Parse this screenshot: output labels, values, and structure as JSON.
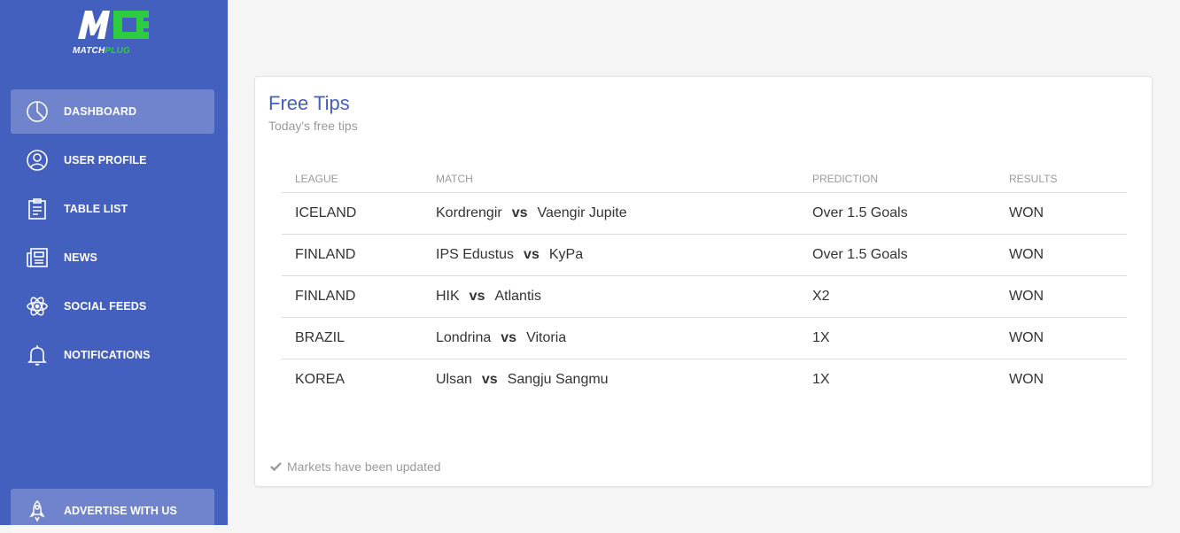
{
  "brand": {
    "logo_letters": "MC",
    "word_part1": "MATCH",
    "word_part2": "PLUG",
    "accent": "#2ecc40",
    "sidebar_color": "#4460bf"
  },
  "sidebar": {
    "items": [
      {
        "label": "DASHBOARD",
        "icon": "pie-chart-icon",
        "active": true
      },
      {
        "label": "USER PROFILE",
        "icon": "user-icon",
        "active": false
      },
      {
        "label": "TABLE LIST",
        "icon": "clipboard-icon",
        "active": false
      },
      {
        "label": "NEWS",
        "icon": "newspaper-icon",
        "active": false
      },
      {
        "label": "SOCIAL FEEDS",
        "icon": "atom-icon",
        "active": false
      },
      {
        "label": "NOTIFICATIONS",
        "icon": "bell-icon",
        "active": false
      }
    ],
    "bottom": {
      "label": "ADVERTISE WITH US",
      "icon": "rocket-icon"
    }
  },
  "card": {
    "title": "Free Tips",
    "subtitle": "Today's free tips",
    "columns": [
      "LEAGUE",
      "MATCH",
      "PREDICTION",
      "RESULTS"
    ],
    "vs_label": "vs",
    "rows": [
      {
        "league": "ICELAND",
        "home": "Kordrengir",
        "away": "Vaengir Jupite",
        "prediction": "Over 1.5 Goals",
        "result": "WON"
      },
      {
        "league": "FINLAND",
        "home": "IPS Edustus",
        "away": "KyPa",
        "prediction": "Over 1.5 Goals",
        "result": "WON"
      },
      {
        "league": "FINLAND",
        "home": "HIK",
        "away": "Atlantis",
        "prediction": "X2",
        "result": "WON"
      },
      {
        "league": "BRAZIL",
        "home": "Londrina",
        "away": "Vitoria",
        "prediction": "1X",
        "result": "WON"
      },
      {
        "league": "KOREA",
        "home": "Ulsan",
        "away": "Sangju Sangmu",
        "prediction": "1X",
        "result": "WON"
      }
    ],
    "footer": "Markets have been updated"
  }
}
